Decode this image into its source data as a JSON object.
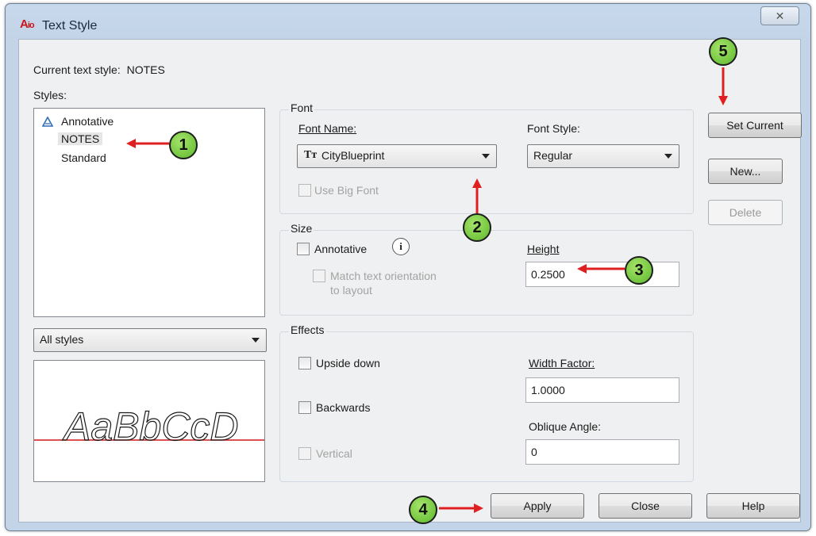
{
  "window": {
    "title": "Text Style",
    "close_glyph": "✕"
  },
  "current_style": {
    "label": "Current text style:",
    "value": "NOTES"
  },
  "styles": {
    "label": "Styles:",
    "items": [
      {
        "label": "Annotative",
        "icon": "annotative-icon"
      },
      {
        "label": "NOTES",
        "selected": true
      },
      {
        "label": "Standard"
      }
    ],
    "filter": "All styles",
    "preview_text": "AaBbCcD"
  },
  "font": {
    "group_label": "Font",
    "font_name_label": "Font Name:",
    "font_name_value": "CityBlueprint",
    "font_style_label": "Font Style:",
    "font_style_value": "Regular",
    "big_font_label": "Use Big Font"
  },
  "size": {
    "group_label": "Size",
    "annotative_label": "Annotative",
    "info_glyph": "i",
    "match_label_line1": "Match text orientation",
    "match_label_line2": "to layout",
    "height_label": "Height",
    "height_value": "0.2500"
  },
  "effects": {
    "group_label": "Effects",
    "upside_down_label": "Upside down",
    "backwards_label": "Backwards",
    "vertical_label": "Vertical",
    "width_factor_label": "Width Factor:",
    "width_factor_value": "1.0000",
    "oblique_label": "Oblique Angle:",
    "oblique_value": "0"
  },
  "buttons": {
    "set_current": "Set Current",
    "new": "New...",
    "delete": "Delete",
    "apply": "Apply",
    "close": "Close",
    "help": "Help"
  },
  "callouts": [
    "1",
    "2",
    "3",
    "4",
    "5"
  ],
  "colors": {
    "callout_fill": "#6cc237",
    "arrow": "#e02020",
    "preview_baseline": "#d01818"
  }
}
